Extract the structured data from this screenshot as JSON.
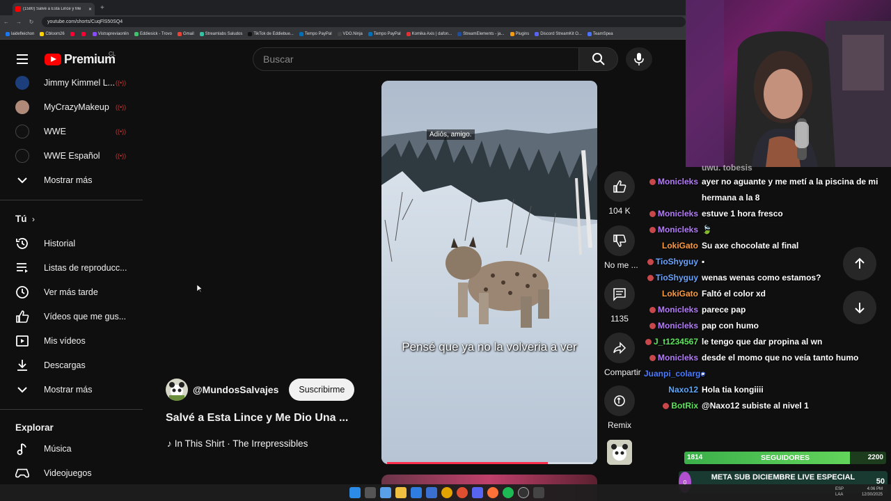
{
  "browser": {
    "tab_title": "(1580) Salvé a Esta Lince y Me",
    "new_tab": "+",
    "url": "youtube.com/shorts/CuqFlS50SQ4",
    "bookmarks": [
      "laidefleichon",
      "Cbloom26",
      "",
      "",
      "Vistrapreviaonlin",
      "Eddiesick - Trovo",
      "Gmail",
      "Streamlabs Saludos",
      "TikTok de Eddiebue...",
      "Tempo PayPal",
      "VDO.Ninja",
      "Tempo PayPal",
      "Komika Axis | dafon...",
      "StreamElements - ja...",
      "Plugins",
      "Discord StreamKit O...",
      "TeamSpea"
    ]
  },
  "header": {
    "logo_text": "Premium",
    "country": "CL",
    "search_placeholder": "Buscar"
  },
  "sidebar": {
    "subscriptions": [
      {
        "label": "Jimmy Kimmel L...",
        "live": "((•))"
      },
      {
        "label": "MyCrazyMakeup",
        "live": "((•))"
      },
      {
        "label": "WWE",
        "live": "((•))"
      },
      {
        "label": "WWE Español",
        "live": "((•))"
      }
    ],
    "show_more_1": "Mostrar más",
    "you_section": "Tú",
    "you_items": [
      {
        "label": "Historial",
        "icon": "history-icon"
      },
      {
        "label": "Listas de reproducc...",
        "icon": "playlist-icon"
      },
      {
        "label": "Ver más tarde",
        "icon": "clock-icon"
      },
      {
        "label": "Vídeos que me gus...",
        "icon": "thumb-up-icon"
      },
      {
        "label": "Mis vídeos",
        "icon": "my-videos-icon"
      },
      {
        "label": "Descargas",
        "icon": "download-icon"
      }
    ],
    "show_more_2": "Mostrar más",
    "explore_section": "Explorar",
    "explore_items": [
      {
        "label": "Música",
        "icon": "music-icon"
      },
      {
        "label": "Videojuegos",
        "icon": "gamepad-icon"
      }
    ]
  },
  "short": {
    "channel": "@MundosSalvajes",
    "subscribe": "Suscribirme",
    "title": "Salvé a Esta Lince y Me Dio Una ...",
    "music": "In This Shirt · The Irrepressibles",
    "subtitle_top": "Adiós, amigo.",
    "caption": "Pensé que ya no la volveria a ver",
    "progress": 0.78
  },
  "actions": {
    "likes": "104 K",
    "dislike": "No me ...",
    "comments": "1135",
    "share": "Compartir",
    "remix": "Remix"
  },
  "chat": {
    "messages": [
      {
        "user": "Monicleks",
        "text": "ayer no aguante y me metí a la piscina de mi",
        "color": "#b57bff",
        "badge": true
      },
      {
        "user": "",
        "text": "hermana a la 8",
        "color": "#b57bff",
        "badge": false
      },
      {
        "user": "Monicleks",
        "text": "estuve 1 hora fresco",
        "color": "#b57bff",
        "badge": true
      },
      {
        "user": "Monicleks",
        "text": "🍃",
        "color": "#b57bff",
        "badge": true
      },
      {
        "user": "LokiGato",
        "text": "Su axe chocolate al final",
        "color": "#ff9a3c",
        "badge": false
      },
      {
        "user": "TioShyguy",
        "text": "▪",
        "color": "#6aa3ff",
        "badge": true
      },
      {
        "user": "TioShyguy",
        "text": "wenas wenas como estamos?",
        "color": "#6aa3ff",
        "badge": true
      },
      {
        "user": "LokiGato",
        "text": "Faltó el color xd",
        "color": "#ff9a3c",
        "badge": false
      },
      {
        "user": "Monicleks",
        "text": "parece pap",
        "color": "#b57bff",
        "badge": true
      },
      {
        "user": "Monicleks",
        "text": "pap con humo",
        "color": "#b57bff",
        "badge": true
      },
      {
        "user": "J_t1234567",
        "text": "le tengo que dar propina al wn",
        "color": "#5fe25f",
        "badge": true
      },
      {
        "user": "Monicleks",
        "text": "desde el momo que no veía tanto humo",
        "color": "#b57bff",
        "badge": true
      },
      {
        "user": "Juanpi_colargo",
        "text": "▪",
        "color": "#4b7bff",
        "badge": false
      },
      {
        "user": "Naxo12",
        "text": "Hola tia kongiiii",
        "color": "#5aa7ff",
        "badge": false
      },
      {
        "user": "BotRix",
        "text": "@Naxo12 subiste al nivel 1",
        "color": "#5fe25f",
        "badge": true
      }
    ]
  },
  "overlay": {
    "followers_current": "1814",
    "followers_label": "SEGUIDORES",
    "followers_goal": "2200",
    "followers_progress": 0.82,
    "sub_goal_count": "0",
    "sub_goal_text": "META SUB DICIEMBRE LIVE ESPECIAL",
    "sub_goal_target": "50"
  },
  "taskbar": {
    "lang": "ESP",
    "lang2": "LAA",
    "time": "4:06 PM",
    "date": "12/30/2025"
  }
}
